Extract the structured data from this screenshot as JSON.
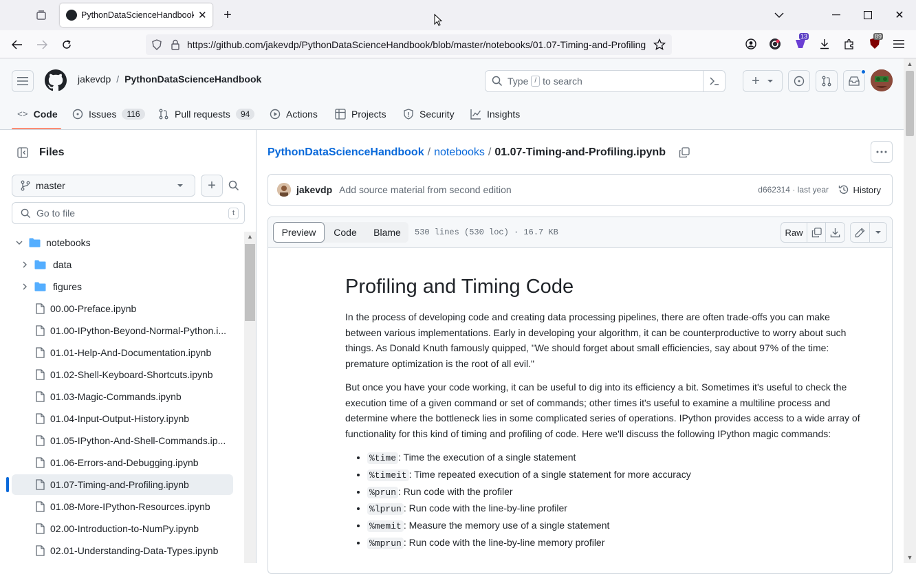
{
  "browser": {
    "tab_title": "PythonDataScienceHandbook/",
    "url": "https://github.com/jakevdp/PythonDataScienceHandbook/blob/master/notebooks/01.07-Timing-and-Profiling",
    "badge_ext1": "13",
    "badge_ext2": "89"
  },
  "header": {
    "owner": "jakevdp",
    "separator": "/",
    "repo": "PythonDataScienceHandbook",
    "search_placeholder_pre": "Type",
    "search_key": "/",
    "search_placeholder_post": "to search"
  },
  "repo_nav": [
    {
      "label": "Code",
      "count": ""
    },
    {
      "label": "Issues",
      "count": "116"
    },
    {
      "label": "Pull requests",
      "count": "94"
    },
    {
      "label": "Actions",
      "count": ""
    },
    {
      "label": "Projects",
      "count": ""
    },
    {
      "label": "Security",
      "count": ""
    },
    {
      "label": "Insights",
      "count": ""
    }
  ],
  "sidebar": {
    "title": "Files",
    "branch": "master",
    "goto_placeholder": "Go to file",
    "goto_key": "t",
    "tree": [
      {
        "label": "notebooks",
        "type": "folder-open"
      },
      {
        "label": "data",
        "type": "folder"
      },
      {
        "label": "figures",
        "type": "folder"
      },
      {
        "label": "00.00-Preface.ipynb",
        "type": "file"
      },
      {
        "label": "01.00-IPython-Beyond-Normal-Python.i...",
        "type": "file"
      },
      {
        "label": "01.01-Help-And-Documentation.ipynb",
        "type": "file"
      },
      {
        "label": "01.02-Shell-Keyboard-Shortcuts.ipynb",
        "type": "file"
      },
      {
        "label": "01.03-Magic-Commands.ipynb",
        "type": "file"
      },
      {
        "label": "01.04-Input-Output-History.ipynb",
        "type": "file"
      },
      {
        "label": "01.05-IPython-And-Shell-Commands.ip...",
        "type": "file"
      },
      {
        "label": "01.06-Errors-and-Debugging.ipynb",
        "type": "file"
      },
      {
        "label": "01.07-Timing-and-Profiling.ipynb",
        "type": "file-selected"
      },
      {
        "label": "01.08-More-IPython-Resources.ipynb",
        "type": "file"
      },
      {
        "label": "02.00-Introduction-to-NumPy.ipynb",
        "type": "file"
      },
      {
        "label": "02.01-Understanding-Data-Types.ipynb",
        "type": "file"
      }
    ]
  },
  "breadcrumb": {
    "repo": "PythonDataScienceHandbook",
    "sep1": "/",
    "folder": "notebooks",
    "sep2": "/",
    "file": "01.07-Timing-and-Profiling.ipynb"
  },
  "commit": {
    "author": "jakevdp",
    "message": "Add source material from second edition",
    "sha_time": "d662314 · last year",
    "history": "History"
  },
  "file_toolbar": {
    "tabs": [
      "Preview",
      "Code",
      "Blame"
    ],
    "info": "530 lines (530 loc) · 16.7 KB",
    "raw": "Raw"
  },
  "content": {
    "heading": "Profiling and Timing Code",
    "p1": "In the process of developing code and creating data processing pipelines, there are often trade-offs you can make between various implementations. Early in developing your algorithm, it can be counterproductive to worry about such things. As Donald Knuth famously quipped, \"We should forget about small efficiencies, say about 97% of the time: premature optimization is the root of all evil.\"",
    "p2": "But once you have your code working, it can be useful to dig into its efficiency a bit. Sometimes it's useful to check the execution time of a given command or set of commands; other times it's useful to examine a multiline process and determine where the bottleneck lies in some complicated series of operations. IPython provides access to a wide array of functionality for this kind of timing and profiling of code. Here we'll discuss the following IPython magic commands:",
    "items": [
      {
        "code": "%time",
        "text": ": Time the execution of a single statement"
      },
      {
        "code": "%timeit",
        "text": ": Time repeated execution of a single statement for more accuracy"
      },
      {
        "code": "%prun",
        "text": ": Run code with the profiler"
      },
      {
        "code": "%lprun",
        "text": ": Run code with the line-by-line profiler"
      },
      {
        "code": "%memit",
        "text": ": Measure the memory use of a single statement"
      },
      {
        "code": "%mprun",
        "text": ": Run code with the line-by-line memory profiler"
      }
    ]
  },
  "colors": {
    "accent": "#0969da",
    "selected_bar": "#0969da",
    "folder": "#54aeff",
    "tab_underline": "#fd8c73"
  }
}
